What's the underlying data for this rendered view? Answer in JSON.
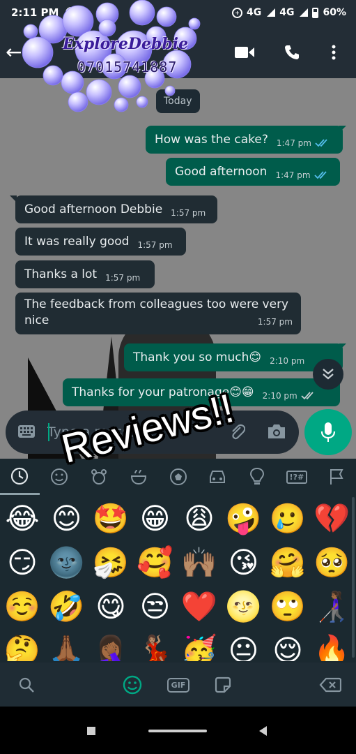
{
  "status_bar": {
    "time": "2:11 PM",
    "notification": "B",
    "network_1": "4G",
    "network_2": "4G",
    "battery": "60%"
  },
  "watermark": {
    "name": "ExploreDebbie",
    "phone": "07015741887"
  },
  "chat": {
    "date_chip": "Today",
    "messages": [
      {
        "direction": "out",
        "text": "How was the cake?",
        "time": "1:47 pm",
        "status": "read"
      },
      {
        "direction": "out",
        "text": "Good afternoon",
        "time": "1:47 pm",
        "status": "read"
      },
      {
        "direction": "in",
        "text": "Good afternoon Debbie",
        "time": "1:57 pm"
      },
      {
        "direction": "in",
        "text": "It was really good",
        "time": "1:57 pm"
      },
      {
        "direction": "in",
        "text": "Thanks a lot",
        "time": "1:57 pm"
      },
      {
        "direction": "in",
        "text": "The feedback from colleagues too were very nice",
        "time": "1:57 pm"
      },
      {
        "direction": "out",
        "text": "Thank you so much😊",
        "time": "2:10 pm",
        "status": "read"
      },
      {
        "direction": "out",
        "text": "Thanks for your patronage😊😁",
        "time": "2:10 pm",
        "status": "read"
      }
    ]
  },
  "input": {
    "placeholder": "Type a message"
  },
  "overlay_text": "Reviews!!",
  "emoji_keyboard": {
    "categories": [
      "recent-icon",
      "smileys-icon",
      "animals-icon",
      "food-icon",
      "activity-icon",
      "travel-icon",
      "objects-icon",
      "symbols-icon",
      "flags-icon"
    ],
    "symbols_label": "!?#",
    "gif_label": "GIF",
    "emojis": [
      "😂",
      "😊",
      "🤩",
      "😁",
      "😩",
      "🤪",
      "🥲",
      "💔",
      "😏",
      "🌚",
      "🤧",
      "🥰",
      "🙌🏽",
      "😘",
      "🤗",
      "🥺",
      "☺️",
      "🤣",
      "😋",
      "😒",
      "❤️",
      "🌝",
      "🙄",
      "👩🏾‍🦯",
      "🤔",
      "🙏🏾",
      "🤦🏾‍♀️",
      "💃🏽",
      "🥳",
      "😐",
      "😌",
      "🔥"
    ]
  },
  "colors": {
    "header_bg": "#232d36",
    "outgoing_bubble": "#005c4b",
    "incoming_bubble": "#202c33",
    "accent": "#00a884",
    "read_tick": "#53bdeb"
  }
}
